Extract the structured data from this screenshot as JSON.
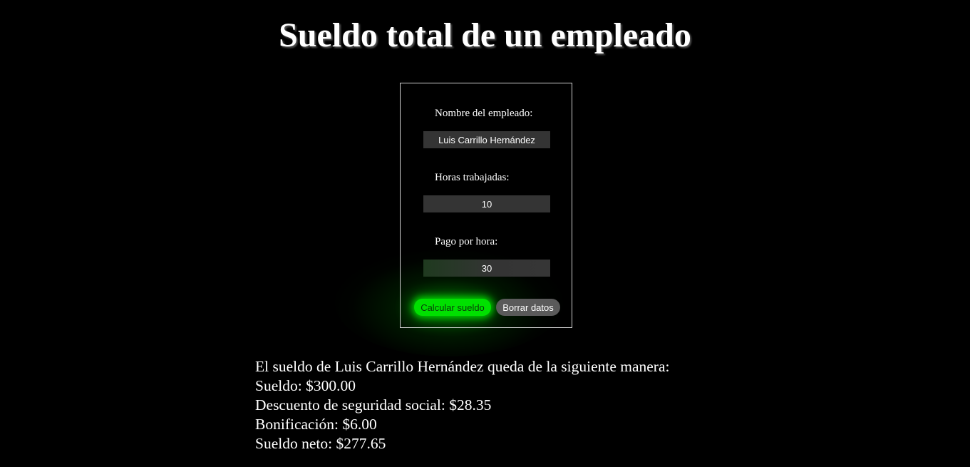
{
  "page": {
    "title": "Sueldo total de un empleado"
  },
  "form": {
    "name_label": "Nombre del empleado:",
    "name_value": "Luis Carrillo Hernández",
    "hours_label": "Horas trabajadas:",
    "hours_value": "10",
    "rate_label": "Pago por hora:",
    "rate_value": "30",
    "calc_button": "Calcular sueldo",
    "clear_button": "Borrar datos"
  },
  "results": {
    "intro": "El sueldo de Luis Carrillo Hernández queda de la siguiente manera:",
    "salary": "Sueldo: $300.00",
    "social_security": "Descuento de seguridad social: $28.35",
    "bonus": "Bonificación: $6.00",
    "net_salary": "Sueldo neto: $277.65"
  },
  "colors": {
    "background": "#000000",
    "accent_green": "#00e000",
    "input_bg": "#343434",
    "clear_button_bg": "#5a5a5a"
  }
}
